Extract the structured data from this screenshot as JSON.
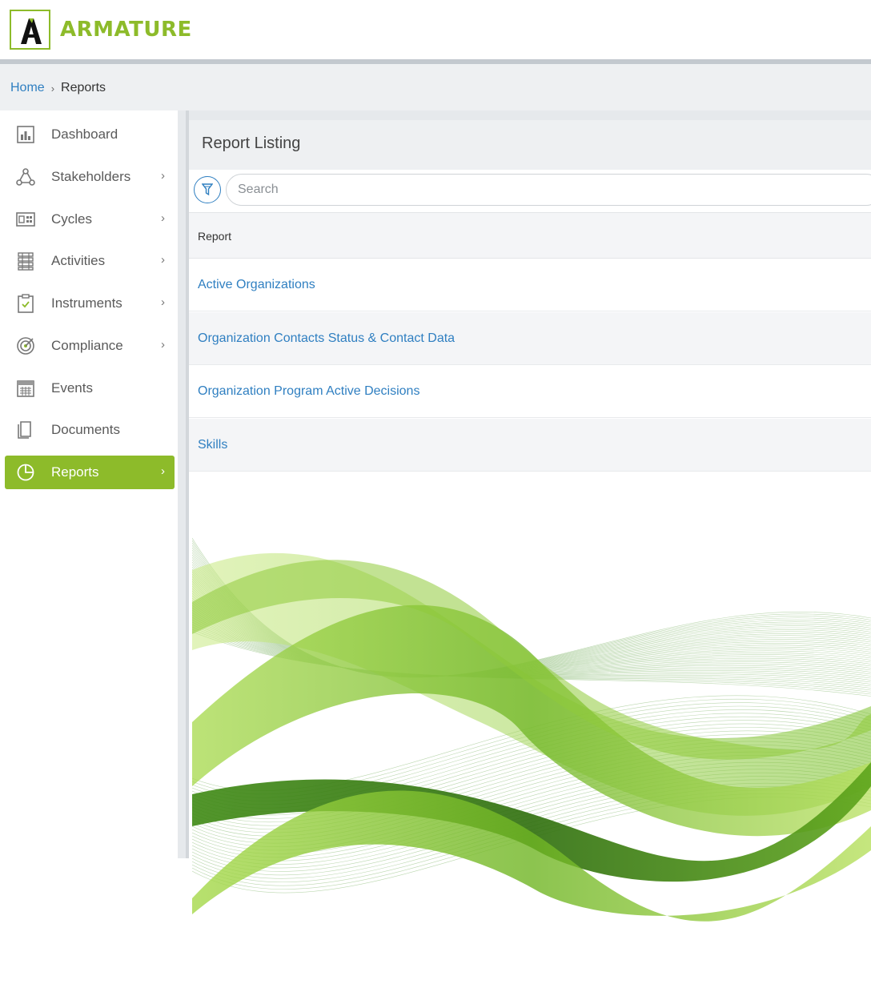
{
  "header": {
    "brand": "ARMATURE",
    "logo_letter": "A"
  },
  "colors": {
    "brand_green": "#8dbb2a",
    "link_blue": "#2f7fc1"
  },
  "breadcrumb": {
    "home": "Home",
    "separator": "›",
    "current": "Reports"
  },
  "sidebar": {
    "items": [
      {
        "label": "Dashboard",
        "icon": "dashboard-icon",
        "has_chevron": false,
        "active": false
      },
      {
        "label": "Stakeholders",
        "icon": "stakeholders-icon",
        "has_chevron": true,
        "active": false
      },
      {
        "label": "Cycles",
        "icon": "cycles-icon",
        "has_chevron": true,
        "active": false
      },
      {
        "label": "Activities",
        "icon": "activities-icon",
        "has_chevron": true,
        "active": false
      },
      {
        "label": "Instruments",
        "icon": "instruments-icon",
        "has_chevron": true,
        "active": false
      },
      {
        "label": "Compliance",
        "icon": "compliance-icon",
        "has_chevron": true,
        "active": false
      },
      {
        "label": "Events",
        "icon": "events-icon",
        "has_chevron": false,
        "active": false
      },
      {
        "label": "Documents",
        "icon": "documents-icon",
        "has_chevron": false,
        "active": false
      },
      {
        "label": "Reports",
        "icon": "reports-icon",
        "has_chevron": true,
        "active": true
      }
    ],
    "chevron": "›"
  },
  "main": {
    "title": "Report Listing",
    "search": {
      "placeholder": "Search",
      "value": ""
    },
    "table": {
      "column_header": "Report",
      "rows": [
        "Active Organizations",
        "Organization Contacts Status & Contact Data",
        "Organization Program Active Decisions",
        "Skills"
      ]
    }
  }
}
